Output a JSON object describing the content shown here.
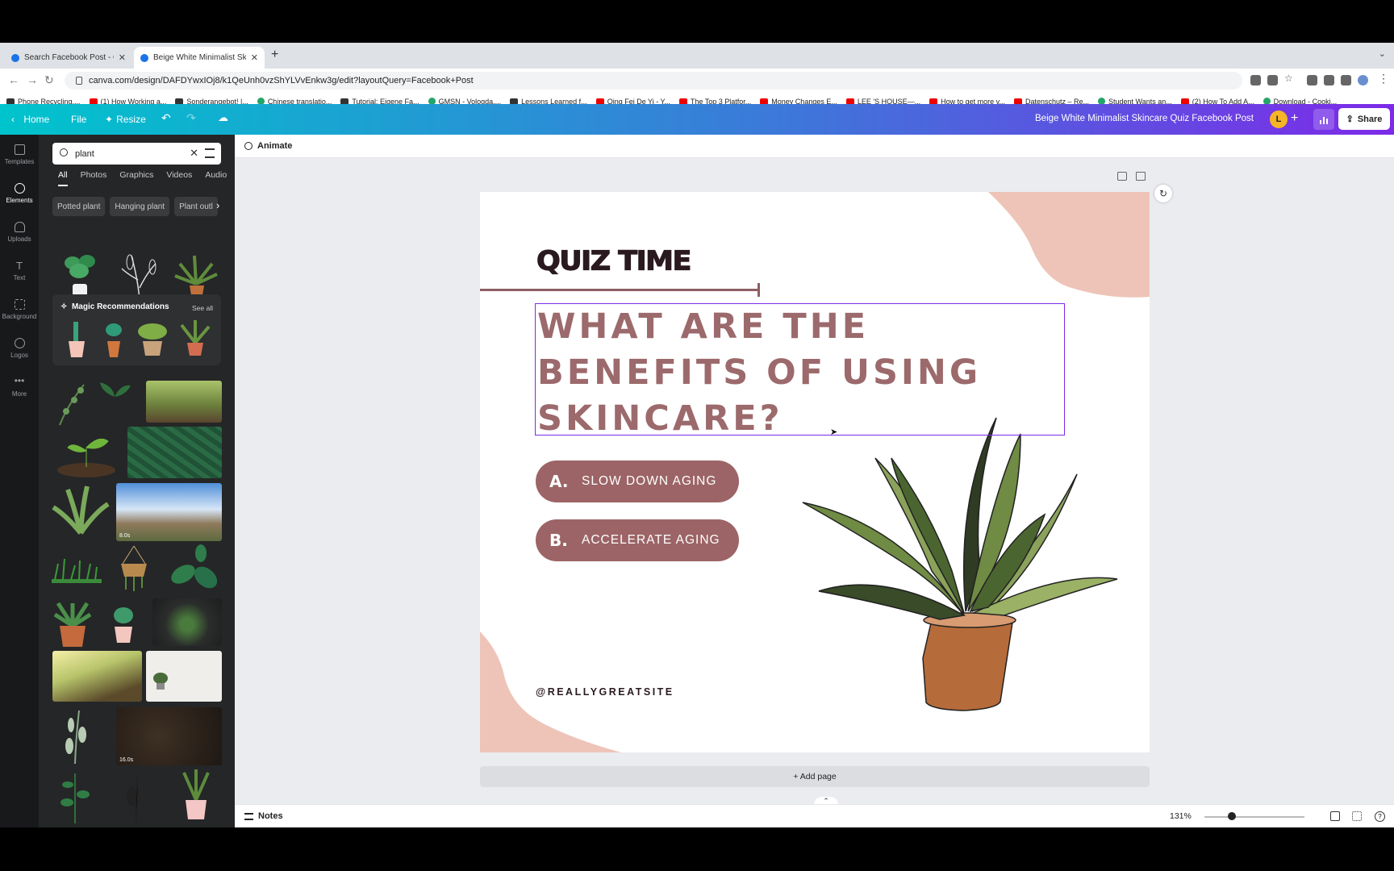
{
  "browser": {
    "tabs": [
      {
        "title": "Search Facebook Post - Canva"
      },
      {
        "title": "Beige White Minimalist Skincare"
      }
    ],
    "url": "canva.com/design/DAFDYwxIOj8/k1QeUnh0vzShYLVvEnkw3g/edit?layoutQuery=Facebook+Post",
    "bookmarks": [
      "Phone Recycling,...",
      "(1) How Working a...",
      "Sonderangebot! |...",
      "Chinese translatio...",
      "Tutorial: Eigene Fa...",
      "GMSN - Vologda,...",
      "Lessons Learned f...",
      "Qing Fei De Yi - Y...",
      "The Top 3 Platfor...",
      "Money Changes E...",
      "LEE 'S HOUSE—...",
      "How to get more v...",
      "Datenschutz – Re...",
      "Student Wants an...",
      "(2) How To Add A...",
      "Download - Cooki..."
    ]
  },
  "header": {
    "home": "Home",
    "file": "File",
    "resize": "Resize",
    "design_title": "Beige White Minimalist Skincare Quiz Facebook Post",
    "avatar_letter": "L",
    "share": "Share"
  },
  "rail": [
    {
      "label": "Templates",
      "icon": "templates-icon"
    },
    {
      "label": "Elements",
      "icon": "elements-icon"
    },
    {
      "label": "Uploads",
      "icon": "upload-icon"
    },
    {
      "label": "Text",
      "icon": "text-icon"
    },
    {
      "label": "Background",
      "icon": "background-icon"
    },
    {
      "label": "Logos",
      "icon": "logos-icon"
    },
    {
      "label": "More",
      "icon": "more-icon"
    }
  ],
  "panel": {
    "search_value": "plant",
    "tabs": [
      "All",
      "Photos",
      "Graphics",
      "Videos",
      "Audio"
    ],
    "chips": [
      "Potted plant",
      "Hanging plant",
      "Plant outl"
    ],
    "magic_title": "Magic Recommendations",
    "see_all": "See all",
    "durations": [
      "8.0s",
      "16.0s"
    ]
  },
  "toolbar": {
    "animate": "Animate"
  },
  "design": {
    "quiz_title": "QUIZ TIME",
    "question": "WHAT ARE THE BENEFITS OF USING SKINCARE?",
    "answers": [
      {
        "letter": "A.",
        "text": "SLOW DOWN AGING"
      },
      {
        "letter": "B.",
        "text": "ACCELERATE AGING"
      }
    ],
    "site": "@REALLYGREATSITE",
    "colors": {
      "accent": "#9c6466",
      "blob": "#eec4b8",
      "title": "#2a1a20"
    }
  },
  "add_page": "+ Add page",
  "footer": {
    "notes": "Notes",
    "zoom": "131%"
  }
}
